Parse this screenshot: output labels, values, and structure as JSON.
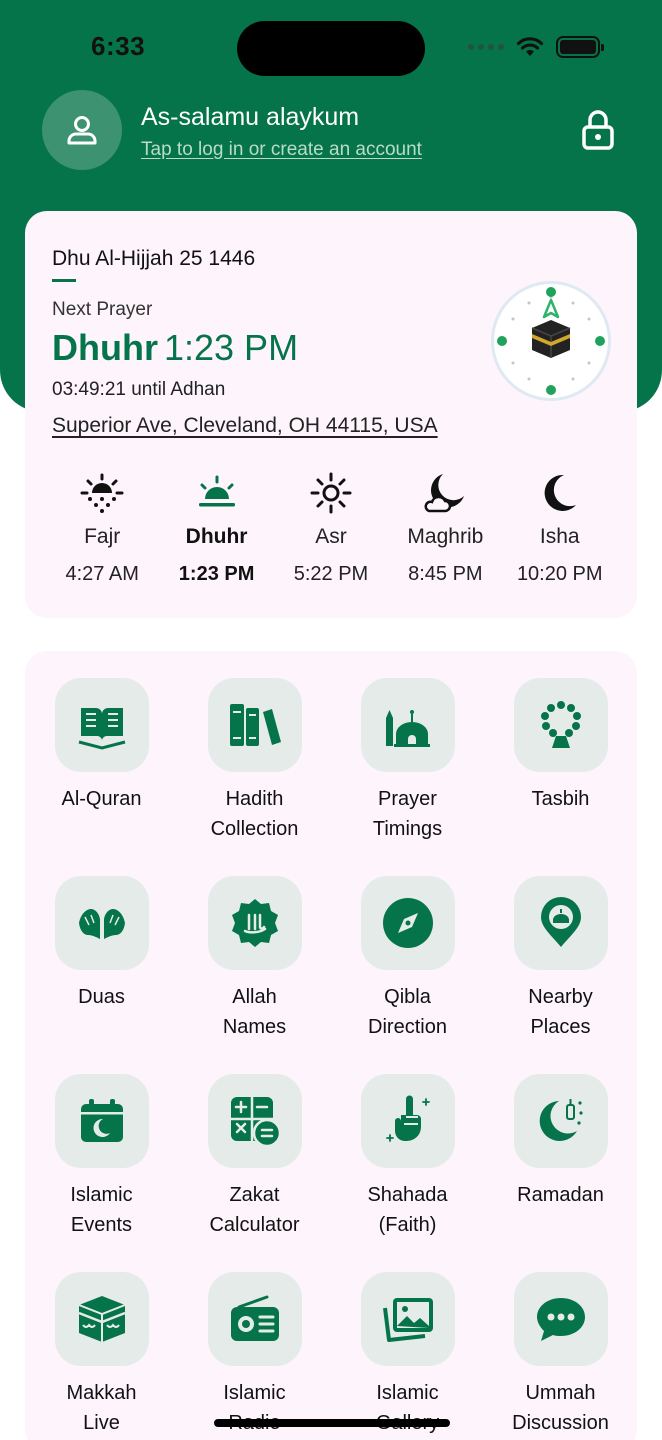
{
  "status_bar": {
    "time": "6:33"
  },
  "header": {
    "greeting": "As-salamu alaykum",
    "login_prompt": "Tap to log in or create an account",
    "avatar_icon": "user-icon",
    "lock_icon": "lock-icon"
  },
  "prayer_card": {
    "hijri_date": "Dhu Al-Hijjah 25 1446",
    "next_prayer_label": "Next Prayer",
    "next_prayer_name": "Dhuhr",
    "next_prayer_time": "1:23 PM",
    "countdown": "03:49:21 until Adhan",
    "location": "Superior Ave, Cleveland, OH 44115, USA",
    "prayers": [
      {
        "name": "Fajr",
        "time": "4:27 AM",
        "icon": "sunrise-dotted-icon",
        "active": false
      },
      {
        "name": "Dhuhr",
        "time": "1:23 PM",
        "icon": "sun-horizon-icon",
        "active": true
      },
      {
        "name": "Asr",
        "time": "5:22 PM",
        "icon": "sun-icon",
        "active": false
      },
      {
        "name": "Maghrib",
        "time": "8:45 PM",
        "icon": "moon-cloud-icon",
        "active": false
      },
      {
        "name": "Isha",
        "time": "10:20 PM",
        "icon": "crescent-moon-icon",
        "active": false
      }
    ]
  },
  "features": [
    {
      "label": "Al-Quran",
      "icon": "quran-book-icon"
    },
    {
      "label": "Hadith\nCollection",
      "icon": "books-icon"
    },
    {
      "label": "Prayer\nTimings",
      "icon": "mosque-icon"
    },
    {
      "label": "Tasbih",
      "icon": "prayer-beads-icon"
    },
    {
      "label": "Duas",
      "icon": "praying-hands-icon"
    },
    {
      "label": "Allah\nNames",
      "icon": "allah-calligraphy-icon"
    },
    {
      "label": "Qibla\nDirection",
      "icon": "compass-icon"
    },
    {
      "label": "Nearby\nPlaces",
      "icon": "mosque-pin-icon"
    },
    {
      "label": "Islamic\nEvents",
      "icon": "calendar-moon-icon"
    },
    {
      "label": "Zakat\nCalculator",
      "icon": "calculator-icon"
    },
    {
      "label": "Shahada\n(Faith)",
      "icon": "raised-finger-icon"
    },
    {
      "label": "Ramadan",
      "icon": "crescent-lantern-icon"
    },
    {
      "label": "Makkah\nLive",
      "icon": "kaaba-icon"
    },
    {
      "label": "Islamic\nRadio",
      "icon": "radio-icon"
    },
    {
      "label": "Islamic\nGallery",
      "icon": "gallery-icon"
    },
    {
      "label": "Ummah\nDiscussion",
      "icon": "chat-bubble-icon"
    }
  ],
  "colors": {
    "primary": "#06744a",
    "card_bg": "#fdf5fb",
    "tile_bg": "#e5ebe9"
  }
}
